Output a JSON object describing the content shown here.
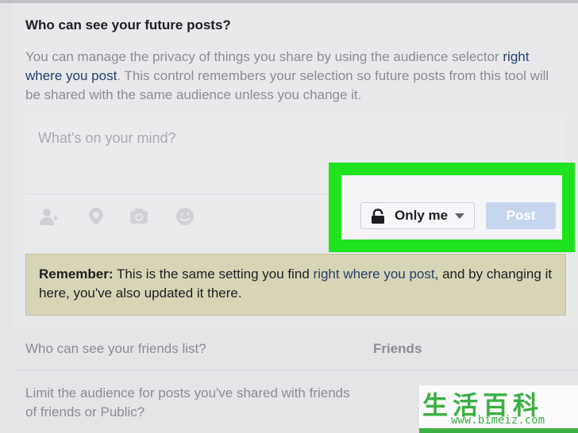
{
  "section": {
    "heading": "Who can see your future posts?",
    "description_before": "You can manage the privacy of things you share by using the audience selector ",
    "description_link": "right where you post",
    "description_after": ". This control remembers your selection so future posts from this tool will be shared with the same audience unless you change it."
  },
  "composer": {
    "placeholder": "What's on your mind?",
    "icons": [
      "tag-friends-icon",
      "location-pin-icon",
      "camera-icon",
      "emoji-icon"
    ],
    "audience_label": "Only me",
    "post_label": "Post"
  },
  "remember": {
    "bold": "Remember:",
    "text_before": " This is the same setting you find ",
    "link": "right where you post",
    "text_after": ", and by changing it here, you've also updated it there."
  },
  "rows": [
    {
      "label": "Who can see your friends list?",
      "value": "Friends"
    },
    {
      "label": "Limit the audience for posts you've shared with friends of friends or Public?"
    }
  ],
  "watermark": {
    "chars": "生活百科",
    "url": "www.bimeiz.com"
  },
  "colors": {
    "highlight": "#1ee31e",
    "link": "#23406b",
    "post_button": "#c7d6ef",
    "remember_bg": "#d8d5b6"
  }
}
